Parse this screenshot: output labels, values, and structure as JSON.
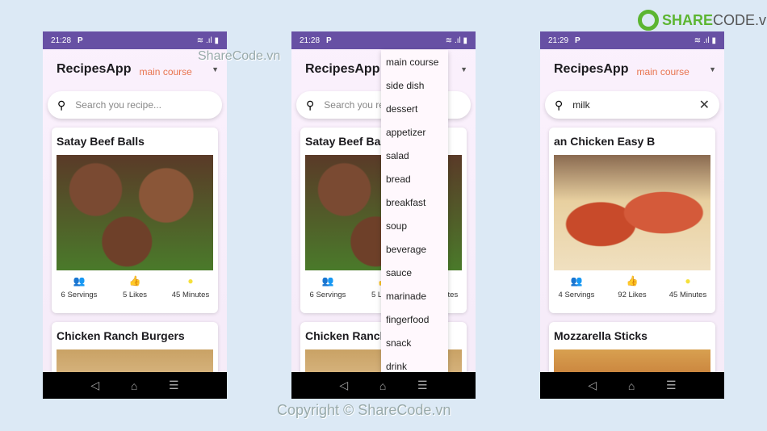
{
  "logo": {
    "text_a": "SHARE",
    "text_b": "CODE.vn"
  },
  "watermarks": {
    "top": "ShareCode.vn",
    "bottom": "Copyright © ShareCode.vn"
  },
  "colors": {
    "status_bar": "#6750a4",
    "category": "#e8744f",
    "servings_icon": "#7ed67e",
    "likes_icon": "#2a88e8",
    "time_icon": "#f5e03a"
  },
  "phones": [
    {
      "time": "21:28",
      "app_title": "RecipesApp",
      "category": "main course",
      "search_placeholder": "Search you recipe...",
      "search_value": "",
      "cards": [
        {
          "title": "Satay Beef Balls",
          "servings": "6 Servings",
          "likes": "5 Likes",
          "minutes": "45 Minutes",
          "image": "meatballs"
        },
        {
          "title": "Chicken Ranch Burgers",
          "image": "burger"
        }
      ]
    },
    {
      "time": "21:28",
      "app_title": "RecipesApp",
      "category": "main course",
      "search_placeholder": "Search you recipe...",
      "search_value": "",
      "cards": [
        {
          "title": "Satay Beef Balls",
          "servings": "6 Servings",
          "likes": "5 Likes",
          "minutes": "45 Minutes",
          "image": "meatballs"
        },
        {
          "title": "Chicken Ranch Burgers",
          "image": "burger"
        }
      ],
      "dropdown": [
        "main course",
        "side dish",
        "dessert",
        "appetizer",
        "salad",
        "bread",
        "breakfast",
        "soup",
        "beverage",
        "sauce",
        "marinade",
        "fingerfood",
        "snack",
        "drink"
      ]
    },
    {
      "time": "21:29",
      "app_title": "RecipesApp",
      "category": "main course",
      "search_placeholder": "Search you recipe...",
      "search_value": "milk",
      "cards": [
        {
          "title": "an Chicken          Easy B",
          "servings": "4 Servings",
          "likes": "92 Likes",
          "minutes": "45 Minutes",
          "image": "spaghetti"
        },
        {
          "title": "Mozzarella Sticks",
          "image": "sticks"
        }
      ]
    }
  ]
}
